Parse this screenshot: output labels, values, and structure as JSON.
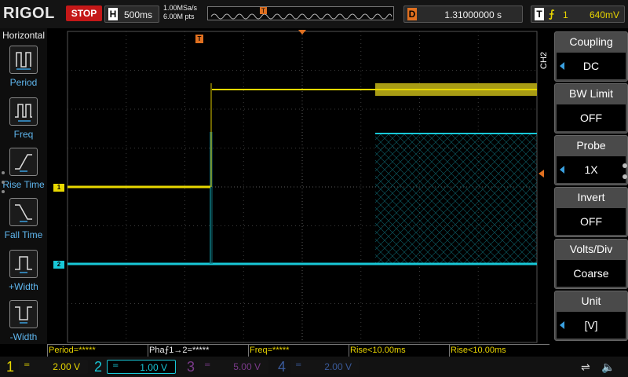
{
  "header": {
    "brand": "RIGOL",
    "run_state": "STOP",
    "horizontal": {
      "label": "H",
      "timebase": "500ms"
    },
    "sample_rate": "1.00MSa/s",
    "memory_depth": "6.00M pts",
    "delay": {
      "label": "D",
      "value": "1.31000000 s"
    },
    "trigger": {
      "label": "T",
      "edge_symbol": "⨍",
      "source": "1",
      "level": "640mV"
    }
  },
  "left_menu": {
    "title": "Horizontal",
    "items": [
      {
        "label": "Period",
        "icon": "period-icon"
      },
      {
        "label": "Freq",
        "icon": "frequency-icon"
      },
      {
        "label": "Rise Time",
        "icon": "rise-time-icon"
      },
      {
        "label": "Fall Time",
        "icon": "fall-time-icon"
      },
      {
        "label": "+Width",
        "icon": "positive-width-icon"
      },
      {
        "label": "-Width",
        "icon": "negative-width-icon"
      }
    ]
  },
  "right_menu": {
    "tab": "CH2",
    "items": [
      {
        "label": "Coupling",
        "value": "DC",
        "has_arrow": true
      },
      {
        "label": "BW Limit",
        "value": "OFF",
        "has_arrow": false
      },
      {
        "label": "Probe",
        "value": "1X",
        "has_arrow": true
      },
      {
        "label": "Invert",
        "value": "OFF",
        "has_arrow": false
      },
      {
        "label": "Volts/Div",
        "value": "Coarse",
        "has_arrow": false
      },
      {
        "label": "Unit",
        "value": "[V]",
        "has_arrow": true
      }
    ]
  },
  "waveform": {
    "ch1_marker": "1",
    "ch2_marker": "2",
    "trigger_marker": "T",
    "ch1_color": "#e8d800",
    "ch2_color": "#18c8d8",
    "trigger_color": "#e07020"
  },
  "measurements": [
    "Period=*****",
    "Pha⨍1→2=*****",
    "Freq=*****",
    "Rise<10.00ms",
    "Rise<10.00ms"
  ],
  "channels": [
    {
      "num": "1",
      "coupling": "=",
      "scale": "2.00 V",
      "color": "#e8d800",
      "active": false
    },
    {
      "num": "2",
      "coupling": "=",
      "scale": "1.00 V",
      "color": "#18c8d8",
      "active": true
    },
    {
      "num": "3",
      "coupling": "=",
      "scale": "5.00 V",
      "color": "#7a3a8a",
      "active": false
    },
    {
      "num": "4",
      "coupling": "=",
      "scale": "2.00 V",
      "color": "#3a5a9a",
      "active": false
    }
  ],
  "status_icons": [
    "usb-icon",
    "speaker-icon"
  ]
}
